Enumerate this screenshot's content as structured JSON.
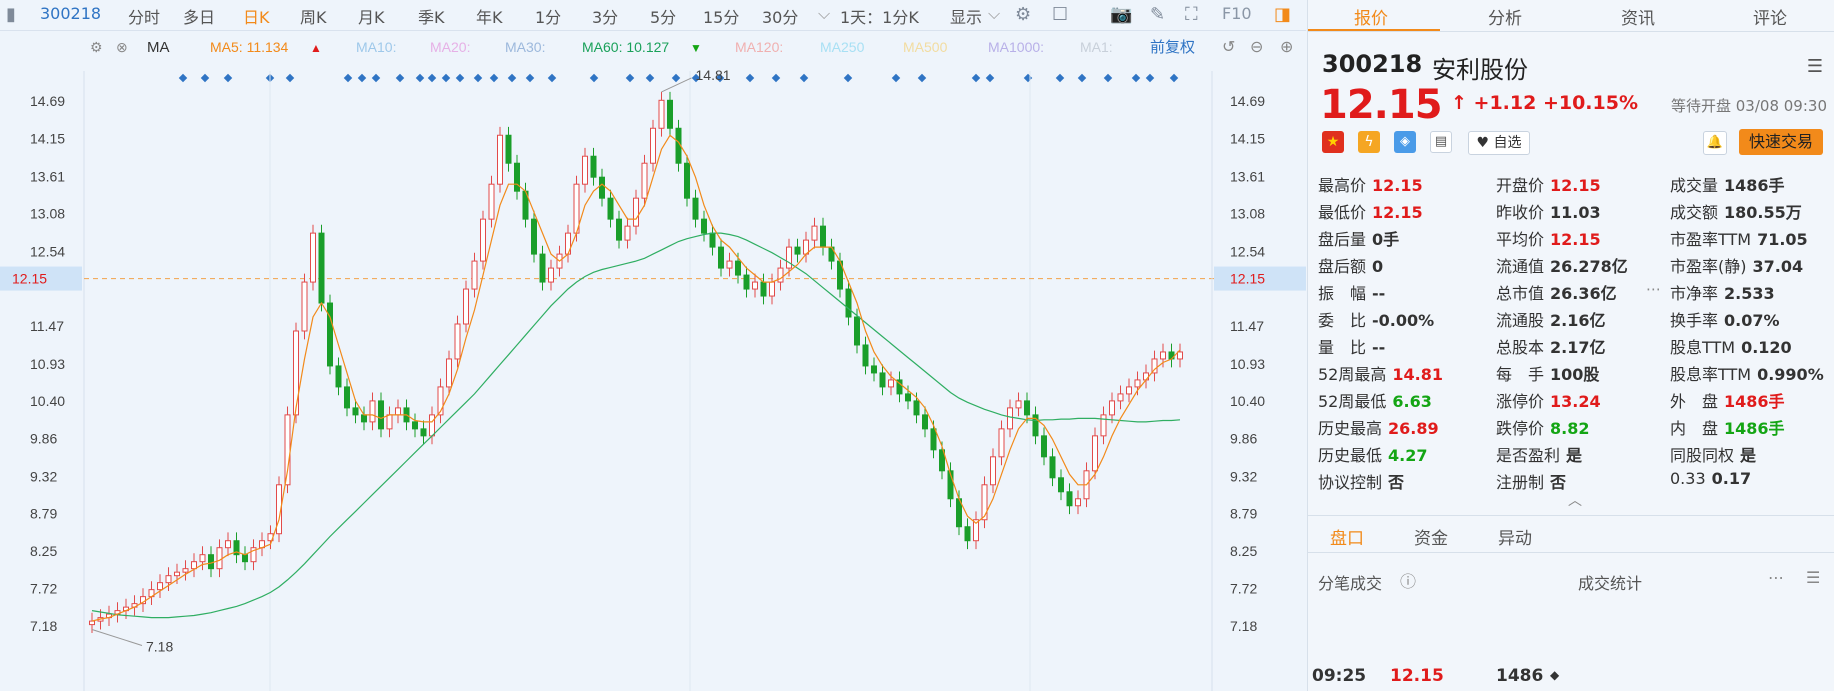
{
  "toolbar": {
    "code": "300218",
    "items": [
      "分时",
      "多日",
      "日K",
      "周K",
      "月K",
      "季K",
      "年K",
      "1分",
      "3分",
      "5分",
      "15分",
      "30分",
      "1天：1分K",
      "显示"
    ],
    "active": "日K",
    "f10": "F10"
  },
  "indicator_bar": {
    "ma_label": "MA",
    "ma5": "MA5: 11.134",
    "ma10": "MA10:",
    "ma20": "MA20:",
    "ma30": "MA30:",
    "ma60": "MA60: 10.127",
    "ma120": "MA120:",
    "ma250": "MA250",
    "ma500": "MA500",
    "ma1000": "MA1000:",
    "ma1": "MA1:",
    "fq": "前复权"
  },
  "chart_data": {
    "type": "candlestick",
    "y_ticks": [
      "14.69",
      "14.15",
      "13.61",
      "13.08",
      "12.54",
      "12.15",
      "11.47",
      "10.93",
      "10.40",
      "9.86",
      "9.32",
      "8.79",
      "8.25",
      "7.72",
      "7.18"
    ],
    "y_range": [
      7.18,
      14.69
    ],
    "current_price": "12.15",
    "high_label": "14.81",
    "low_label": "7.18",
    "closes": [
      7.25,
      7.3,
      7.35,
      7.4,
      7.45,
      7.5,
      7.6,
      7.7,
      7.8,
      7.9,
      7.95,
      8.0,
      8.1,
      8.2,
      8.0,
      8.3,
      8.4,
      8.2,
      8.1,
      8.3,
      8.4,
      8.5,
      9.2,
      10.2,
      11.4,
      12.1,
      12.8,
      11.8,
      10.9,
      10.6,
      10.3,
      10.2,
      10.1,
      10.4,
      10.0,
      10.2,
      10.3,
      10.1,
      10.0,
      9.9,
      10.2,
      10.6,
      11.0,
      11.5,
      12.0,
      12.4,
      13.0,
      13.5,
      14.2,
      13.8,
      13.4,
      13.0,
      12.5,
      12.1,
      12.3,
      12.5,
      12.8,
      13.5,
      13.9,
      13.6,
      13.3,
      13.0,
      12.7,
      12.9,
      13.3,
      13.8,
      14.3,
      14.7,
      14.3,
      13.8,
      13.3,
      13.0,
      12.8,
      12.6,
      12.3,
      12.4,
      12.2,
      12.0,
      12.1,
      11.9,
      12.1,
      12.3,
      12.6,
      12.5,
      12.7,
      12.9,
      12.6,
      12.4,
      12.0,
      11.6,
      11.2,
      10.9,
      10.8,
      10.6,
      10.7,
      10.5,
      10.4,
      10.2,
      10.0,
      9.7,
      9.4,
      9.0,
      8.6,
      8.4,
      8.7,
      9.2,
      9.6,
      10.0,
      10.3,
      10.4,
      10.2,
      9.9,
      9.6,
      9.3,
      9.1,
      8.9,
      9.0,
      9.4,
      9.9,
      10.2,
      10.4,
      10.5,
      10.6,
      10.7,
      10.8,
      11.0,
      11.1,
      11.0,
      11.1
    ],
    "ma5": [
      7.25,
      7.28,
      7.3,
      7.35,
      7.4,
      7.45,
      7.52,
      7.6,
      7.68,
      7.76,
      7.84,
      7.92,
      7.99,
      8.06,
      8.08,
      8.12,
      8.2,
      8.24,
      8.2,
      8.26,
      8.3,
      8.35,
      8.7,
      9.4,
      10.3,
      11.0,
      11.6,
      11.8,
      11.6,
      11.2,
      10.8,
      10.4,
      10.2,
      10.2,
      10.15,
      10.2,
      10.2,
      10.2,
      10.12,
      10.1,
      10.1,
      10.25,
      10.5,
      10.85,
      11.3,
      11.7,
      12.2,
      12.7,
      13.2,
      13.5,
      13.5,
      13.4,
      13.1,
      12.8,
      12.5,
      12.4,
      12.5,
      12.8,
      13.2,
      13.4,
      13.5,
      13.4,
      13.2,
      13.0,
      13.0,
      13.2,
      13.6,
      14.0,
      14.2,
      14.1,
      13.9,
      13.6,
      13.2,
      12.9,
      12.7,
      12.6,
      12.45,
      12.3,
      12.2,
      12.1,
      12.1,
      12.15,
      12.25,
      12.35,
      12.5,
      12.6,
      12.6,
      12.6,
      12.4,
      12.1,
      11.8,
      11.4,
      11.1,
      10.9,
      10.75,
      10.65,
      10.55,
      10.45,
      10.3,
      10.05,
      9.75,
      9.35,
      9.0,
      8.75,
      8.65,
      8.75,
      9.0,
      9.35,
      9.7,
      10.0,
      10.15,
      10.15,
      10.05,
      9.85,
      9.6,
      9.35,
      9.2,
      9.2,
      9.35,
      9.6,
      9.9,
      10.15,
      10.35,
      10.55,
      10.7,
      10.85,
      10.95,
      11.0,
      11.13
    ],
    "ma60": [
      7.4,
      7.38,
      7.36,
      7.34,
      7.33,
      7.32,
      7.31,
      7.3,
      7.3,
      7.3,
      7.31,
      7.32,
      7.33,
      7.35,
      7.37,
      7.4,
      7.43,
      7.46,
      7.5,
      7.55,
      7.6,
      7.66,
      7.74,
      7.84,
      7.95,
      8.07,
      8.2,
      8.33,
      8.46,
      8.58,
      8.7,
      8.82,
      8.94,
      9.06,
      9.18,
      9.3,
      9.42,
      9.54,
      9.66,
      9.78,
      9.9,
      10.02,
      10.14,
      10.26,
      10.38,
      10.5,
      10.64,
      10.78,
      10.92,
      11.06,
      11.2,
      11.34,
      11.48,
      11.62,
      11.76,
      11.88,
      12.0,
      12.1,
      12.18,
      12.24,
      12.28,
      12.31,
      12.34,
      12.37,
      12.4,
      12.44,
      12.5,
      12.56,
      12.62,
      12.68,
      12.72,
      12.75,
      12.78,
      12.8,
      12.8,
      12.78,
      12.75,
      12.7,
      12.64,
      12.58,
      12.52,
      12.45,
      12.38,
      12.3,
      12.22,
      12.12,
      12.02,
      11.92,
      11.82,
      11.72,
      11.62,
      11.52,
      11.42,
      11.32,
      11.22,
      11.12,
      11.02,
      10.92,
      10.82,
      10.72,
      10.62,
      10.52,
      10.44,
      10.38,
      10.33,
      10.28,
      10.24,
      10.2,
      10.17,
      10.15,
      10.13,
      10.12,
      10.13,
      10.13,
      10.14,
      10.14,
      10.15,
      10.15,
      10.15,
      10.14,
      10.13,
      10.12,
      10.11,
      10.1,
      10.1,
      10.11,
      10.12,
      10.12,
      10.13
    ]
  },
  "right": {
    "tabs": [
      "报价",
      "分析",
      "资讯",
      "评论"
    ],
    "code": "300218",
    "name": "安利股份",
    "price": "12.15",
    "change": "↑ +1.12 +10.15%",
    "status": "等待开盘 03/08 09:30",
    "watch": "♥ 自选",
    "trade": "快速交易",
    "col1": [
      {
        "k": "最高价",
        "v": "12.15",
        "c": "red"
      },
      {
        "k": "最低价",
        "v": "12.15",
        "c": "red"
      },
      {
        "k": "盘后量",
        "v": "0手",
        "c": "dark"
      },
      {
        "k": "盘后额",
        "v": "0",
        "c": "dark"
      },
      {
        "k": "振　幅",
        "v": "--",
        "c": "dark"
      },
      {
        "k": "委　比",
        "v": "-0.00%",
        "c": "dark"
      },
      {
        "k": "量　比",
        "v": "--",
        "c": "dark"
      },
      {
        "k": "52周最高",
        "v": "14.81",
        "c": "red"
      },
      {
        "k": "52周最低",
        "v": "6.63",
        "c": "green"
      },
      {
        "k": "历史最高",
        "v": "26.89",
        "c": "red"
      },
      {
        "k": "历史最低",
        "v": "4.27",
        "c": "green"
      },
      {
        "k": "协议控制",
        "v": "否",
        "c": "dark"
      }
    ],
    "col2": [
      {
        "k": "开盘价",
        "v": "12.15",
        "c": "red"
      },
      {
        "k": "昨收价",
        "v": "11.03",
        "c": "dark"
      },
      {
        "k": "平均价",
        "v": "12.15",
        "c": "red"
      },
      {
        "k": "流通值",
        "v": "26.278亿",
        "c": "dark"
      },
      {
        "k": "总市值",
        "v": "26.36亿",
        "c": "dark"
      },
      {
        "k": "流通股",
        "v": "2.16亿",
        "c": "dark"
      },
      {
        "k": "总股本",
        "v": "2.17亿",
        "c": "dark"
      },
      {
        "k": "每　手",
        "v": "100股",
        "c": "dark"
      },
      {
        "k": "涨停价",
        "v": "13.24",
        "c": "red"
      },
      {
        "k": "跌停价",
        "v": "8.82",
        "c": "green"
      },
      {
        "k": "是否盈利",
        "v": "是",
        "c": "dark"
      },
      {
        "k": "注册制",
        "v": "否",
        "c": "dark"
      }
    ],
    "col3": [
      {
        "k": "成交量",
        "v": "1486手",
        "c": "dark"
      },
      {
        "k": "成交额",
        "v": "180.55万",
        "c": "dark"
      },
      {
        "k": "市盈率TTM",
        "v": "71.05",
        "c": "dark"
      },
      {
        "k": "市盈率(静)",
        "v": "37.04",
        "c": "dark"
      },
      {
        "k": "市净率",
        "v": "2.533",
        "c": "dark"
      },
      {
        "k": "换手率",
        "v": "0.07%",
        "c": "dark"
      },
      {
        "k": "股息TTM",
        "v": "0.120",
        "c": "dark"
      },
      {
        "k": "股息率TTM",
        "v": "0.990%",
        "c": "dark"
      },
      {
        "k": "外　盘",
        "v": "1486手",
        "c": "red"
      },
      {
        "k": "内　盘",
        "v": "1486手",
        "c": "green"
      },
      {
        "k": "同股同权",
        "v": "是",
        "c": "dark"
      },
      {
        "k": "0.33",
        "v": "0.17",
        "c": "dark"
      }
    ],
    "subtabs": [
      "盘口",
      "资金",
      "异动"
    ],
    "trades_title": "分笔成交",
    "stats_title": "成交统计",
    "trade_row": {
      "time": "09:25",
      "price": "12.15",
      "vol": "1486"
    }
  }
}
